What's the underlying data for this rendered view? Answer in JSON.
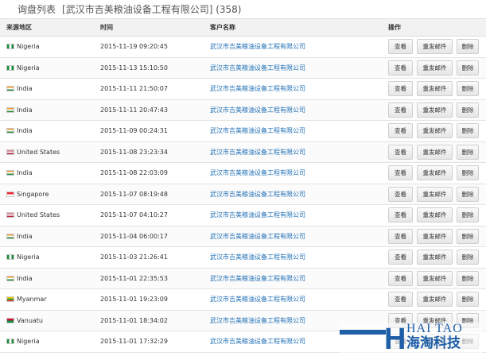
{
  "header": {
    "title": "询盘列表",
    "company": "[武汉市吉美粮油设备工程有限公司]",
    "count": "(358)"
  },
  "table": {
    "columns": {
      "region": "来源地区",
      "time": "时间",
      "customer": "客户名称",
      "ops": "操作"
    },
    "actions": {
      "view": "查看",
      "resend": "重发邮件",
      "delete": "删除"
    },
    "rows": [
      {
        "flag": "nigeria",
        "region": "Nigeria",
        "time": "2015-11-19 09:20:45",
        "customer": "武汉市吉美粮油设备工程有限公司"
      },
      {
        "flag": "nigeria",
        "region": "Nigeria",
        "time": "2015-11-13 15:10:50",
        "customer": "武汉市吉美粮油设备工程有限公司"
      },
      {
        "flag": "india",
        "region": "India",
        "time": "2015-11-11 21:50:07",
        "customer": "武汉市吉美粮油设备工程有限公司"
      },
      {
        "flag": "india",
        "region": "India",
        "time": "2015-11-11 20:47:43",
        "customer": "武汉市吉美粮油设备工程有限公司"
      },
      {
        "flag": "india",
        "region": "India",
        "time": "2015-11-09 00:24:31",
        "customer": "武汉市吉美粮油设备工程有限公司"
      },
      {
        "flag": "united-states",
        "region": "United States",
        "time": "2015-11-08 23:23:34",
        "customer": "武汉市吉美粮油设备工程有限公司"
      },
      {
        "flag": "india",
        "region": "India",
        "time": "2015-11-08 22:03:09",
        "customer": "武汉市吉美粮油设备工程有限公司"
      },
      {
        "flag": "singapore",
        "region": "Singapore",
        "time": "2015-11-07 08:19:48",
        "customer": "武汉市吉美粮油设备工程有限公司"
      },
      {
        "flag": "united-states",
        "region": "United States",
        "time": "2015-11-07 04:10:27",
        "customer": "武汉市吉美粮油设备工程有限公司"
      },
      {
        "flag": "india",
        "region": "India",
        "time": "2015-11-04 06:00:17",
        "customer": "武汉市吉美粮油设备工程有限公司"
      },
      {
        "flag": "nigeria",
        "region": "Nigeria",
        "time": "2015-11-03 21:26:41",
        "customer": "武汉市吉美粮油设备工程有限公司"
      },
      {
        "flag": "india",
        "region": "India",
        "time": "2015-11-01 22:35:53",
        "customer": "武汉市吉美粮油设备工程有限公司"
      },
      {
        "flag": "myanmar",
        "region": "Myanmar",
        "time": "2015-11-01 19:23:09",
        "customer": "武汉市吉美粮油设备工程有限公司"
      },
      {
        "flag": "vanuatu",
        "region": "Vanuatu",
        "time": "2015-11-01 18:34:02",
        "customer": "武汉市吉美粮油设备工程有限公司"
      },
      {
        "flag": "nigeria",
        "region": "Nigeria",
        "time": "2015-11-01 17:32:29",
        "customer": "武汉市吉美粮油设备工程有限公司"
      }
    ]
  },
  "watermark": {
    "letter": "H",
    "en": "HAI TAO",
    "cn": "海淘科技"
  },
  "flag_styles": {
    "nigeria": "linear-gradient(90deg,#1a8a3a 0 33%,#ffffff 33% 66%,#1a8a3a 66%)",
    "india": "linear-gradient(180deg,#f39a2e 0 33%,#ffffff 33% 66%,#2a8a3a 66%)",
    "united-states": "linear-gradient(180deg,#b22234 0 14%,#ffffff 14% 28%,#b22234 28% 42%,#ffffff 42% 57%,#b22234 57% 71%,#ffffff 71% 85%,#b22234 85%)",
    "singapore": "linear-gradient(180deg,#ed2939 0 50%,#ffffff 50%)",
    "myanmar": "linear-gradient(180deg,#fecb00 0 33%,#34b233 33% 66%,#ea2839 66%)",
    "vanuatu": "linear-gradient(180deg,#d21034 0 50%,#009543 50%)"
  }
}
